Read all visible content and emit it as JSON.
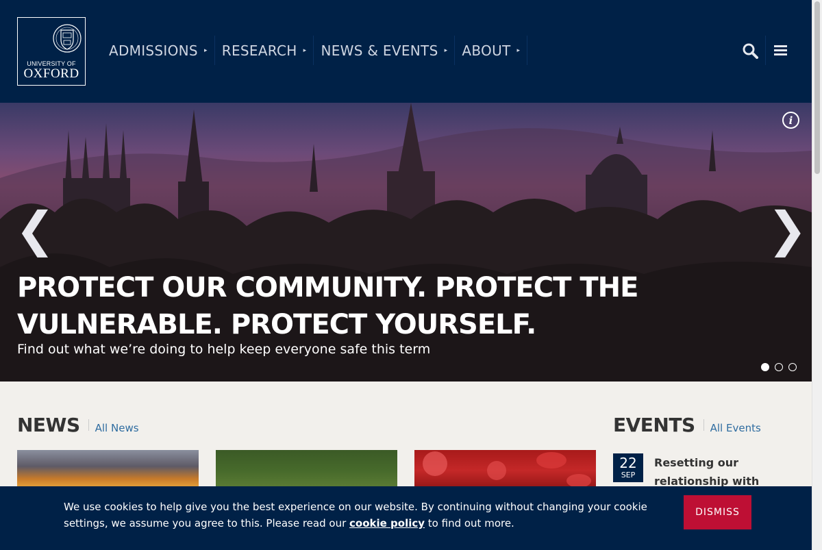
{
  "header": {
    "logo": {
      "line1": "UNIVERSITY OF",
      "line2": "OXFORD"
    },
    "nav": [
      {
        "label": "ADMISSIONS"
      },
      {
        "label": "RESEARCH"
      },
      {
        "label": "NEWS & EVENTS"
      },
      {
        "label": "ABOUT"
      }
    ],
    "caret": "▸",
    "search_icon": "search-icon",
    "menu_icon": "hamburger-menu-icon"
  },
  "hero": {
    "title": "PROTECT OUR COMMUNITY. PROTECT THE VULNERABLE. PROTECT YOURSELF.",
    "subtitle": "Find out what we’re doing to help keep everyone safe this term",
    "info_glyph": "i",
    "prev_glyph": "❮",
    "next_glyph": "❯",
    "slides_total": 3,
    "active_slide": 1
  },
  "news": {
    "heading": "NEWS",
    "link": "All News"
  },
  "events": {
    "heading": "EVENTS",
    "link": "All Events",
    "items": [
      {
        "day": "22",
        "month": "SEP",
        "title": "Resetting our relationship with nature in a post-"
      }
    ]
  },
  "cookie": {
    "text_before": "We use cookies to help give you the best experience on our website. By continuing without changing your cookie settings, we assume you agree to this. Please read our ",
    "link": "cookie policy",
    "text_after": " to find out more.",
    "dismiss_label": "DISMISS"
  },
  "colors": {
    "oxford_blue": "#002147",
    "dismiss_red": "#be0f34",
    "link_blue": "#2f6ca0",
    "background": "#f2f0ec"
  }
}
